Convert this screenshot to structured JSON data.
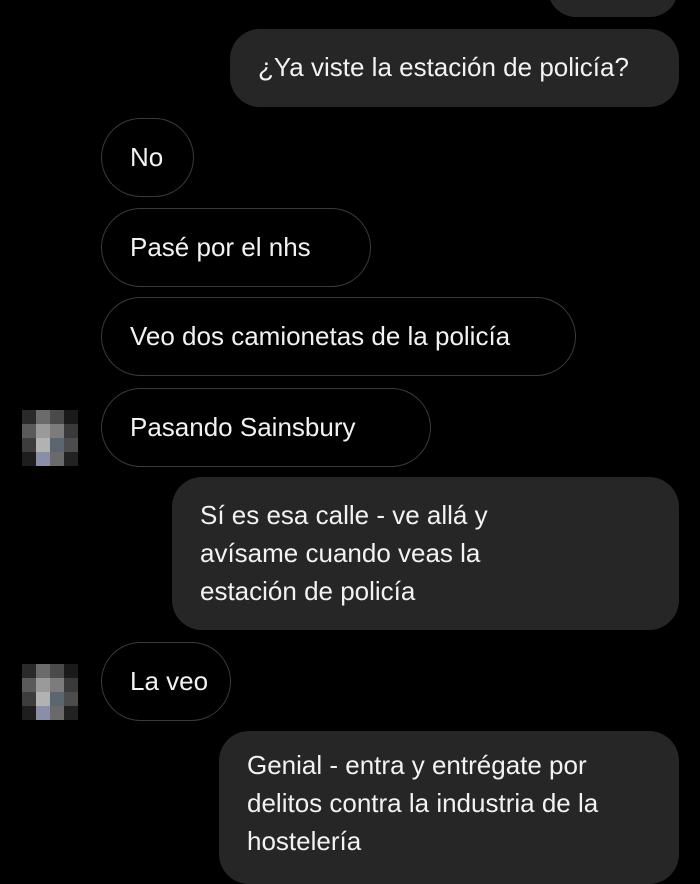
{
  "messages": [
    {
      "id": "m0",
      "direction": "outgoing",
      "text": ""
    },
    {
      "id": "m1",
      "direction": "outgoing",
      "text": "¿Ya viste la estación de policía?"
    },
    {
      "id": "m2",
      "direction": "incoming",
      "text": "No"
    },
    {
      "id": "m3",
      "direction": "incoming",
      "text": "Pasé por el nhs"
    },
    {
      "id": "m4",
      "direction": "incoming",
      "text": "Veo dos camionetas de la policía"
    },
    {
      "id": "m5",
      "direction": "incoming",
      "text": "Pasando Sainsbury",
      "avatar": "avatar-icon"
    },
    {
      "id": "m6",
      "direction": "outgoing",
      "lines": [
        "Sí es esa calle - ve allá y",
        "avísame cuando veas la",
        "estación de policía"
      ]
    },
    {
      "id": "m7",
      "direction": "incoming",
      "text": "La veo",
      "avatar": "avatar-icon"
    },
    {
      "id": "m8",
      "direction": "outgoing",
      "lines": [
        "Genial - entra y entrégate por",
        "delitos contra la industria de la",
        "hostelería"
      ]
    }
  ],
  "colors": {
    "background": "#000000",
    "outgoing_bubble": "#262626",
    "incoming_border": "#3a3a3a",
    "text": "#f2f2f2"
  },
  "avatar": {
    "icon": "pixelated-avatar-icon"
  }
}
